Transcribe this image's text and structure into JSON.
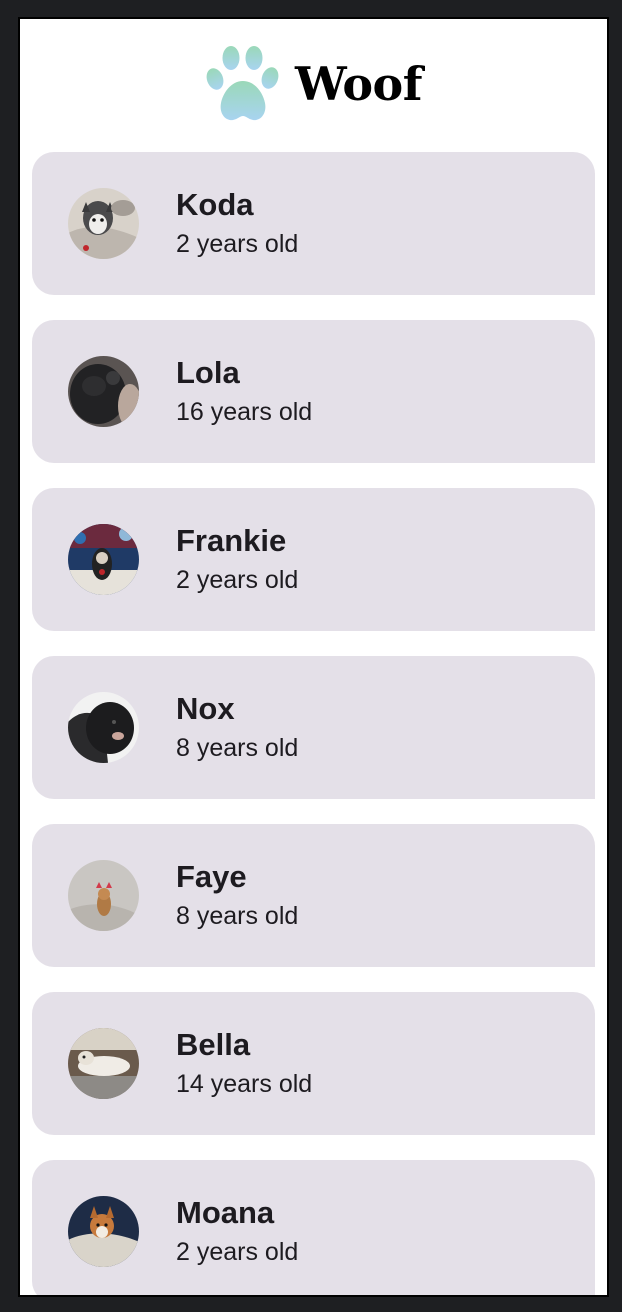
{
  "app": {
    "title": "Woof",
    "logo_icon": "paw-icon",
    "colors": {
      "card_bg": "#e4e0e8",
      "paw_top": "#9ad8b8",
      "paw_bottom": "#a8d4f0"
    }
  },
  "dogs": [
    {
      "name": "Koda",
      "age": "2 years old",
      "avatar": "dog-photo-koda"
    },
    {
      "name": "Lola",
      "age": "16 years old",
      "avatar": "dog-photo-lola"
    },
    {
      "name": "Frankie",
      "age": "2 years old",
      "avatar": "dog-photo-frankie"
    },
    {
      "name": "Nox",
      "age": "8 years old",
      "avatar": "dog-photo-nox"
    },
    {
      "name": "Faye",
      "age": "8 years old",
      "avatar": "dog-photo-faye"
    },
    {
      "name": "Bella",
      "age": "14 years old",
      "avatar": "dog-photo-bella"
    },
    {
      "name": "Moana",
      "age": "2 years old",
      "avatar": "dog-photo-moana"
    }
  ]
}
